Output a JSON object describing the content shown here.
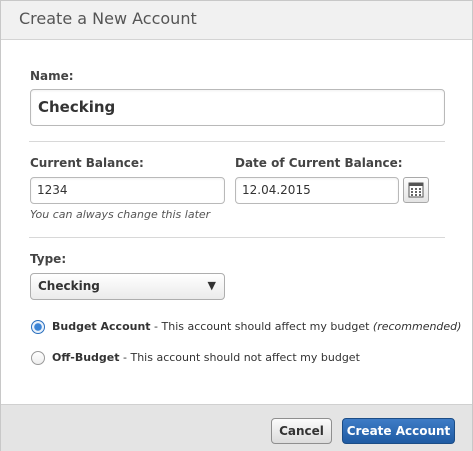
{
  "dialog": {
    "title": "Create a New Account"
  },
  "name": {
    "label": "Name:",
    "value": "Checking"
  },
  "balance": {
    "label": "Current Balance:",
    "value": "1234",
    "hint": "You can always change this later"
  },
  "date": {
    "label": "Date of Current Balance:",
    "value": "12.04.2015",
    "icon": "calendar-icon"
  },
  "type": {
    "label": "Type:",
    "selected": "Checking",
    "arrow": "▼"
  },
  "budget_options": [
    {
      "name": "Budget Account",
      "desc": " - This account should affect my budget ",
      "note": "(recommended)",
      "selected": true
    },
    {
      "name": "Off-Budget",
      "desc": " - This account should not affect my budget",
      "note": "",
      "selected": false
    }
  ],
  "footer": {
    "cancel_label": "Cancel",
    "create_label": "Create Account"
  },
  "colors": {
    "accent": "#2a6fbd",
    "primary_button": "#2b68b0"
  }
}
